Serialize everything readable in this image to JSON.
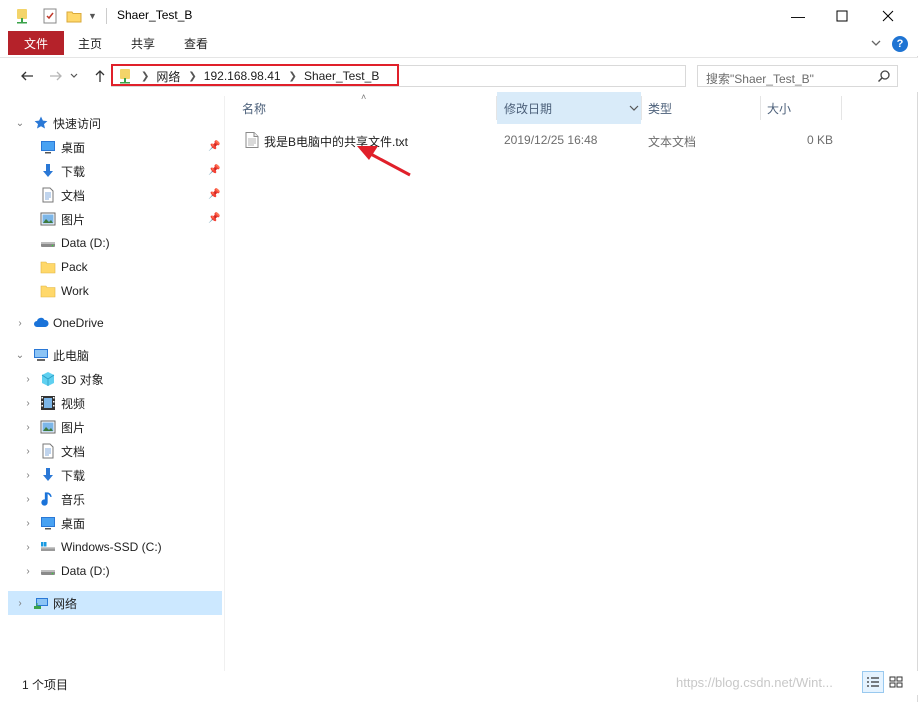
{
  "window": {
    "title": "Shaer_Test_B",
    "minimize_icon": "minimize-icon",
    "maximize_icon": "maximize-icon",
    "close_icon": "close-icon"
  },
  "ribbon": {
    "tabs": [
      {
        "label": "文件",
        "active": true
      },
      {
        "label": "主页"
      },
      {
        "label": "共享"
      },
      {
        "label": "查看"
      }
    ],
    "help_label": "?"
  },
  "address": {
    "breadcrumbs": [
      "网络",
      "192.168.98.41",
      "Shaer_Test_B"
    ],
    "highlight_color": "#e0202a"
  },
  "search": {
    "placeholder": "搜索\"Shaer_Test_B\""
  },
  "sidebar": {
    "quick_access": {
      "label": "快速访问",
      "items": [
        {
          "label": "桌面",
          "icon": "desktop-icon",
          "pinned": true
        },
        {
          "label": "下载",
          "icon": "download-icon",
          "pinned": true
        },
        {
          "label": "文档",
          "icon": "document-icon",
          "pinned": true
        },
        {
          "label": "图片",
          "icon": "pictures-icon",
          "pinned": true
        },
        {
          "label": "Data (D:)",
          "icon": "drive-icon"
        },
        {
          "label": "Pack",
          "icon": "folder-icon"
        },
        {
          "label": "Work",
          "icon": "folder-icon"
        }
      ]
    },
    "onedrive": {
      "label": "OneDrive",
      "icon": "cloud-icon"
    },
    "this_pc": {
      "label": "此电脑",
      "items": [
        {
          "label": "3D 对象",
          "icon": "3d-objects-icon"
        },
        {
          "label": "视频",
          "icon": "video-icon"
        },
        {
          "label": "图片",
          "icon": "pictures-icon"
        },
        {
          "label": "文档",
          "icon": "document-icon"
        },
        {
          "label": "下载",
          "icon": "download-icon"
        },
        {
          "label": "音乐",
          "icon": "music-icon"
        },
        {
          "label": "桌面",
          "icon": "desktop-icon"
        },
        {
          "label": "Windows-SSD (C:)",
          "icon": "os-drive-icon"
        },
        {
          "label": "Data (D:)",
          "icon": "drive-icon"
        }
      ]
    },
    "network": {
      "label": "网络",
      "icon": "network-icon",
      "selected": true
    }
  },
  "columns": [
    {
      "label": "名称"
    },
    {
      "label": "修改日期",
      "sorted": true
    },
    {
      "label": "类型"
    },
    {
      "label": "大小"
    }
  ],
  "files": [
    {
      "name": "我是B电脑中的共享文件.txt",
      "modified": "2019/12/25 16:48",
      "type": "文本文档",
      "size": "0 KB",
      "icon": "text-file-icon"
    }
  ],
  "status": {
    "item_count": "1 个项目"
  },
  "watermark": "https://blog.csdn.net/Wint...",
  "colors": {
    "file_tab": "#b5222a",
    "selection": "#cce8ff",
    "sorted_header": "#d9ebf9",
    "annotation": "#e0202a"
  }
}
